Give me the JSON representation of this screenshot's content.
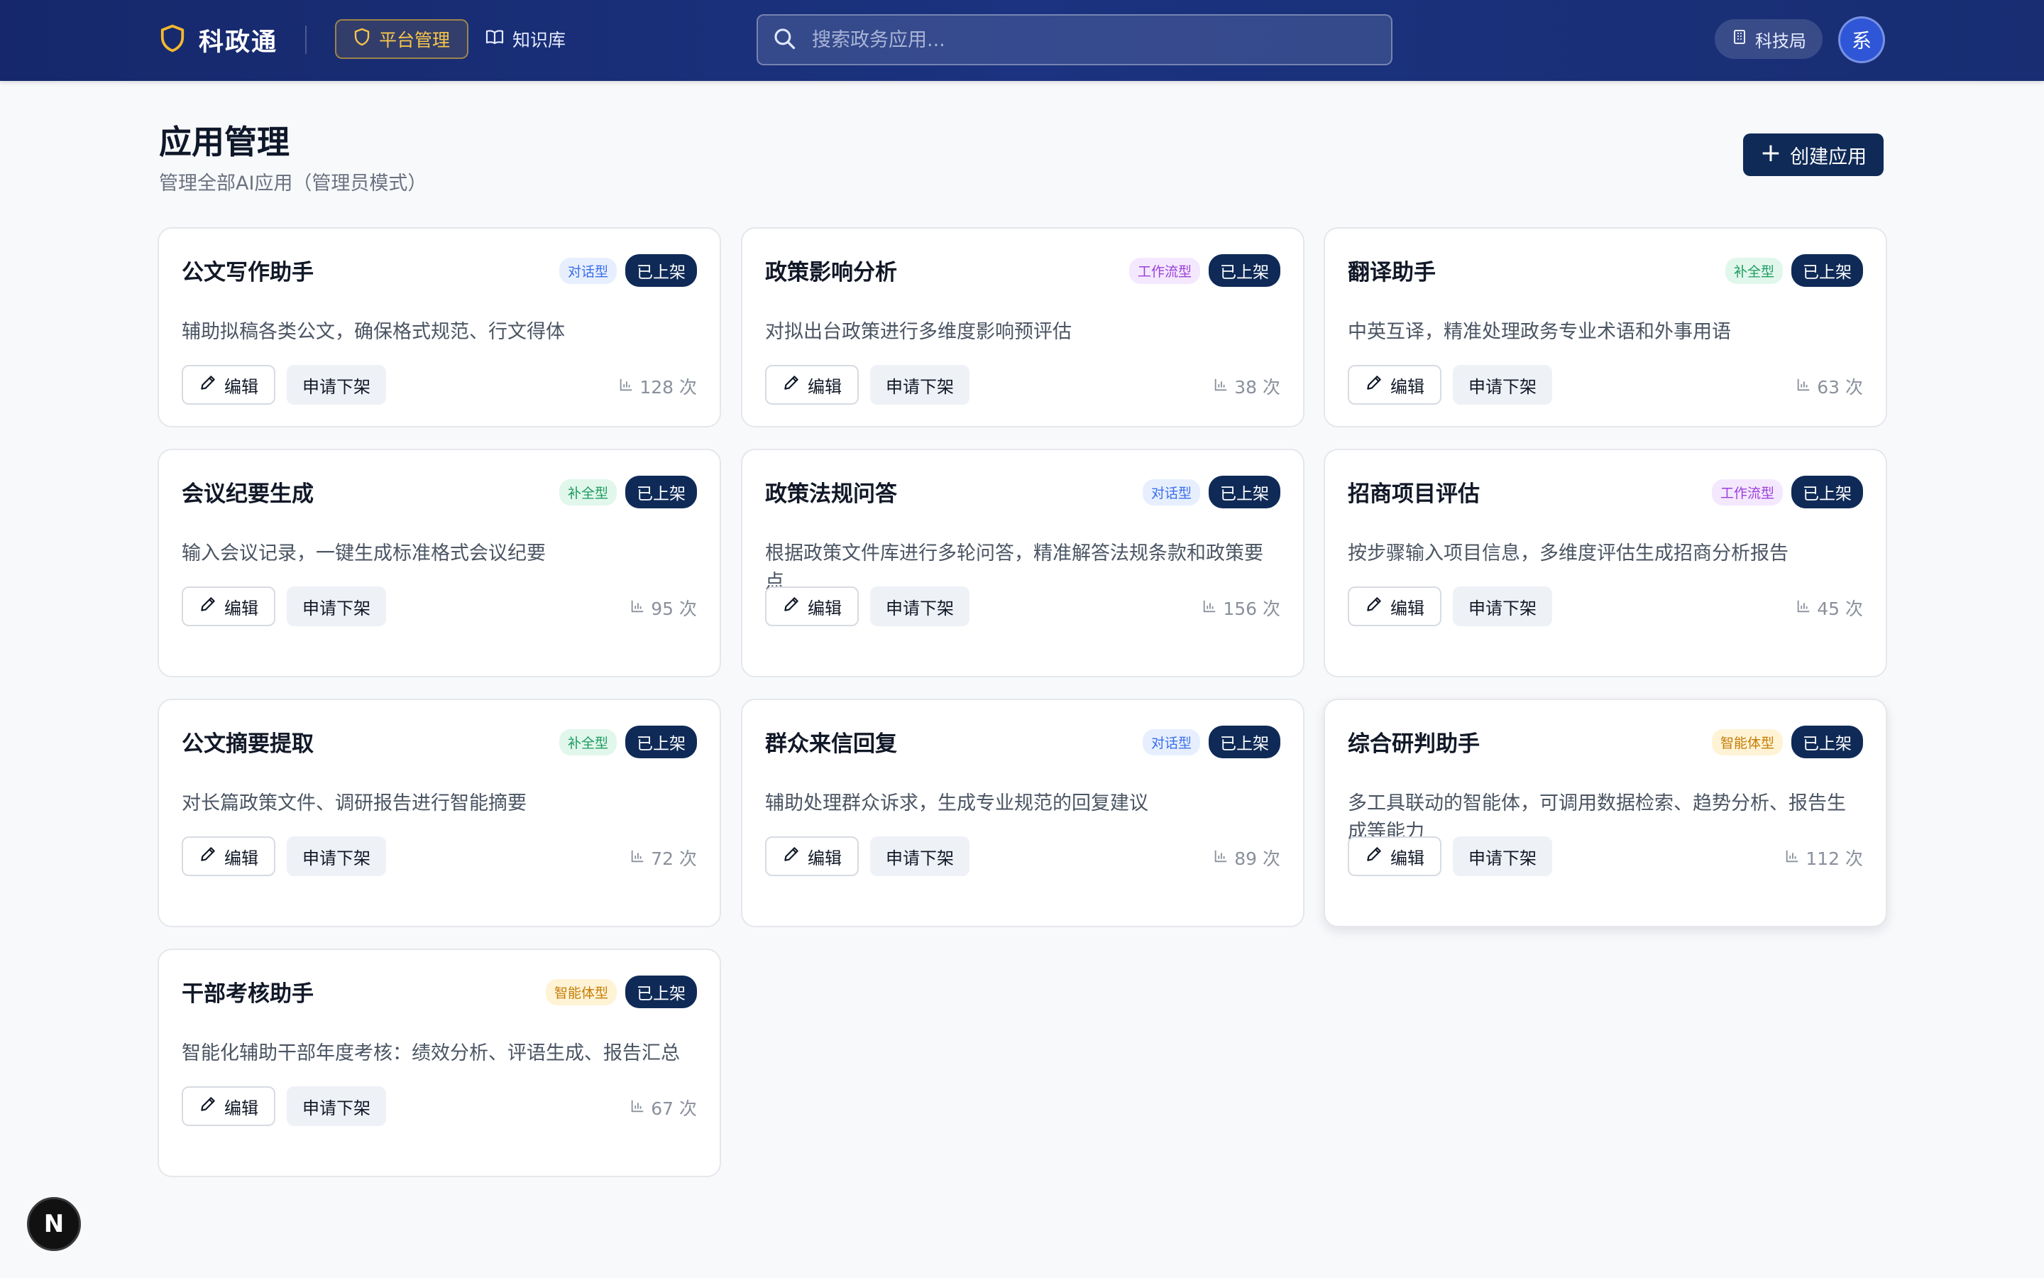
{
  "header": {
    "brand": "科政通",
    "nav": [
      {
        "label": "平台管理",
        "icon": "shield-icon",
        "active": true
      },
      {
        "label": "知识库",
        "icon": "book-icon",
        "active": false
      }
    ],
    "search_placeholder": "搜索政务应用...",
    "org_label": "科技局",
    "avatar_text": "系"
  },
  "page": {
    "title": "应用管理",
    "subtitle": "管理全部AI应用（管理员模式）",
    "create_label": "创建应用"
  },
  "colors": {
    "header_bg": "#1b3380",
    "accent_navy": "#0f2a57",
    "active_nav": "#f6c64a"
  },
  "cards": [
    {
      "title": "公文写作助手",
      "type": "对话型",
      "status": "已上架",
      "desc": "辅助拟稿各类公文，确保格式规范、行文得体",
      "edit": "编辑",
      "off": "申请下架",
      "usage": "128 次"
    },
    {
      "title": "政策影响分析",
      "type": "工作流型",
      "status": "已上架",
      "desc": "对拟出台政策进行多维度影响预评估",
      "edit": "编辑",
      "off": "申请下架",
      "usage": "38 次"
    },
    {
      "title": "翻译助手",
      "type": "补全型",
      "status": "已上架",
      "desc": "中英互译，精准处理政务专业术语和外事用语",
      "edit": "编辑",
      "off": "申请下架",
      "usage": "63 次"
    },
    {
      "title": "会议纪要生成",
      "type": "补全型",
      "status": "已上架",
      "desc": "输入会议记录，一键生成标准格式会议纪要",
      "edit": "编辑",
      "off": "申请下架",
      "usage": "95 次"
    },
    {
      "title": "政策法规问答",
      "type": "对话型",
      "status": "已上架",
      "desc": "根据政策文件库进行多轮问答，精准解答法规条款和政策要点",
      "edit": "编辑",
      "off": "申请下架",
      "usage": "156 次"
    },
    {
      "title": "招商项目评估",
      "type": "工作流型",
      "status": "已上架",
      "desc": "按步骤输入项目信息，多维度评估生成招商分析报告",
      "edit": "编辑",
      "off": "申请下架",
      "usage": "45 次"
    },
    {
      "title": "公文摘要提取",
      "type": "补全型",
      "status": "已上架",
      "desc": "对长篇政策文件、调研报告进行智能摘要",
      "edit": "编辑",
      "off": "申请下架",
      "usage": "72 次"
    },
    {
      "title": "群众来信回复",
      "type": "对话型",
      "status": "已上架",
      "desc": "辅助处理群众诉求，生成专业规范的回复建议",
      "edit": "编辑",
      "off": "申请下架",
      "usage": "89 次"
    },
    {
      "title": "综合研判助手",
      "type": "智能体型",
      "status": "已上架",
      "desc": "多工具联动的智能体，可调用数据检索、趋势分析、报告生成等能力",
      "edit": "编辑",
      "off": "申请下架",
      "usage": "112 次"
    },
    {
      "title": "干部考核助手",
      "type": "智能体型",
      "status": "已上架",
      "desc": "智能化辅助干部年度考核：绩效分析、评语生成、报告汇总",
      "edit": "编辑",
      "off": "申请下架",
      "usage": "67 次"
    }
  ],
  "dev_badge": "N"
}
